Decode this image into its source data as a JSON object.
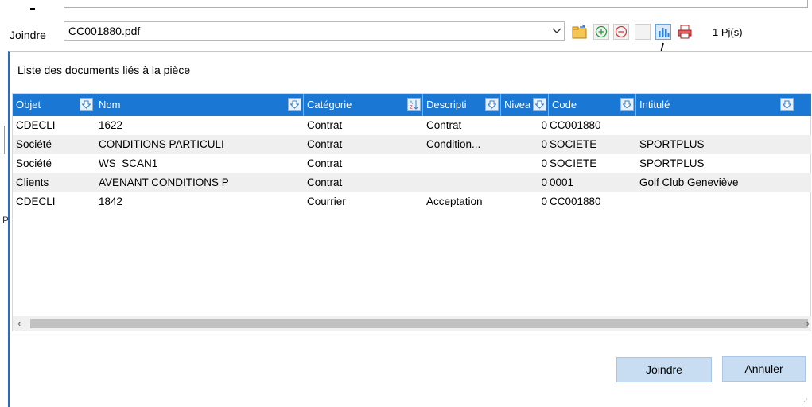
{
  "background": {
    "joindre_label": "Joindre",
    "file_value": "CC001880.pdf",
    "attachments_count": "1 Pj(s)",
    "left_fragment": "P"
  },
  "dialog": {
    "title": "Liste des documents liés à la pièce",
    "columns": [
      {
        "key": "objet",
        "label": "Objet"
      },
      {
        "key": "nom",
        "label": "Nom"
      },
      {
        "key": "categorie",
        "label": "Catégorie"
      },
      {
        "key": "description",
        "label": "Descripti"
      },
      {
        "key": "niveau",
        "label": "Nivea"
      },
      {
        "key": "code",
        "label": "Code"
      },
      {
        "key": "intitule",
        "label": "Intitulé"
      }
    ],
    "rows": [
      {
        "objet": "CDECLI",
        "nom": "1622",
        "categorie": "Contrat",
        "description": "Contrat",
        "niveau": "0",
        "code": "CC001880",
        "intitule": ""
      },
      {
        "objet": "Société",
        "nom": "CONDITIONS PARTICULI",
        "categorie": "Contrat",
        "description": "Condition...",
        "niveau": "0",
        "code": "SOCIETE",
        "intitule": "SPORTPLUS"
      },
      {
        "objet": "Société",
        "nom": "WS_SCAN1",
        "categorie": "Contrat",
        "description": "",
        "niveau": "0",
        "code": "SOCIETE",
        "intitule": "SPORTPLUS"
      },
      {
        "objet": "Clients",
        "nom": "AVENANT CONDITIONS P",
        "categorie": "Contrat",
        "description": "",
        "niveau": "0",
        "code": "0001",
        "intitule": "Golf Club Geneviève"
      },
      {
        "objet": "CDECLI",
        "nom": "1842",
        "categorie": "Courrier",
        "description": "Acceptation",
        "niveau": "0",
        "code": "CC001880",
        "intitule": ""
      }
    ],
    "buttons": {
      "joindre": "Joindre",
      "annuler": "Annuler"
    }
  },
  "colors": {
    "header_bg": "#1a78d4",
    "button_bg": "#c9ddf2",
    "alt_row": "#efefef"
  }
}
